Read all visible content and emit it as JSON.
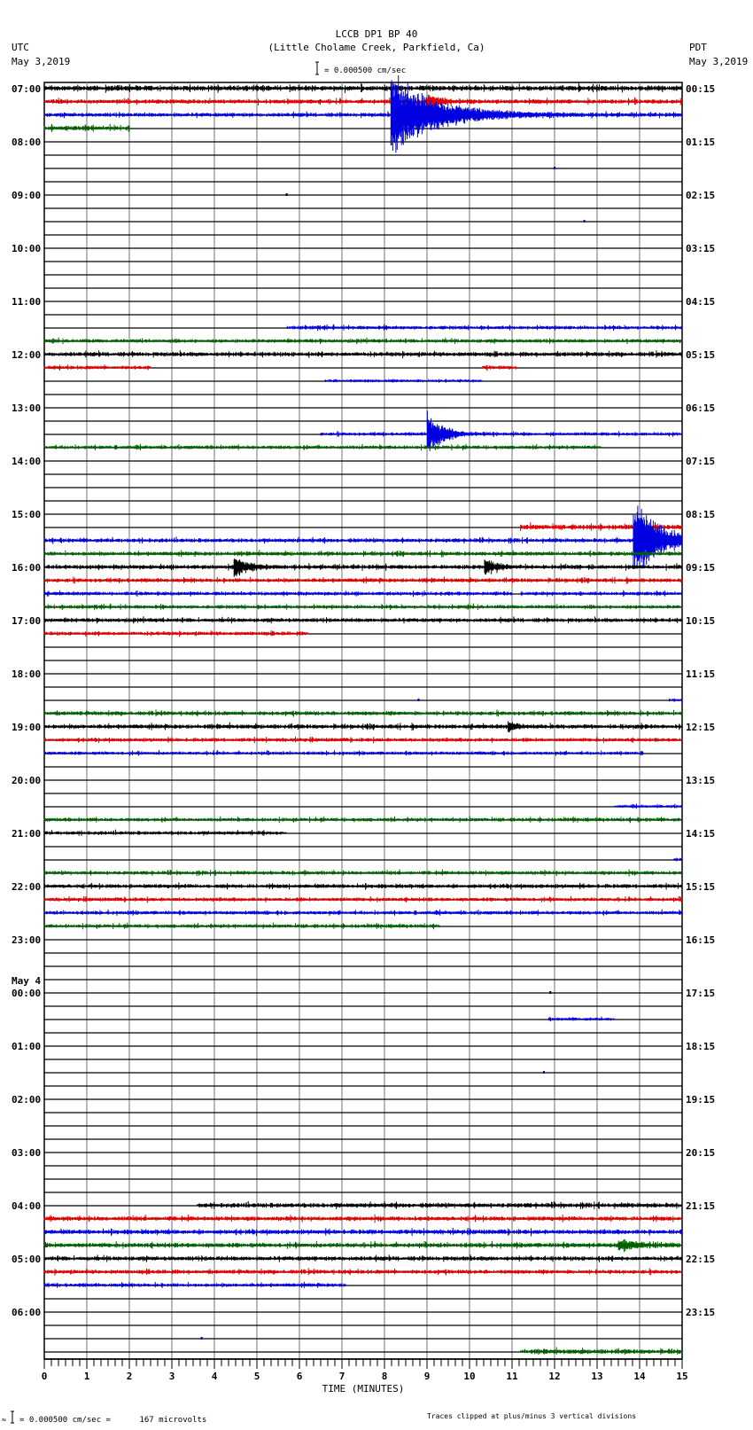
{
  "header": {
    "title": "LCCB DP1 BP 40",
    "subtitle": "(Little Cholame Creek, Parkfield, Ca)",
    "left_tz": "UTC",
    "left_date": "May 3,2019",
    "right_tz": "PDT",
    "right_date": "May 3,2019",
    "scale_text": "= 0.000500 cm/sec"
  },
  "footer": {
    "scale_text": "= 0.000500 cm/sec =      167 microvolts",
    "clip_note": "Traces clipped at plus/minus 3 vertical divisions"
  },
  "chart_data": {
    "type": "line",
    "title": "LCCB DP1 BP 40",
    "xlabel": "TIME (MINUTES)",
    "xlim": [
      0,
      15
    ],
    "x_ticks": [
      "0",
      "1",
      "2",
      "3",
      "4",
      "5",
      "6",
      "7",
      "8",
      "9",
      "10",
      "11",
      "12",
      "13",
      "14",
      "15"
    ],
    "rows_total": 96,
    "row_minutes": 15,
    "clip_divisions": 3,
    "colors": [
      "#000000",
      "#e00000",
      "#0000e0",
      "#006000"
    ],
    "left_labels": [
      "07:00",
      "08:00",
      "09:00",
      "10:00",
      "11:00",
      "12:00",
      "13:00",
      "14:00",
      "15:00",
      "16:00",
      "17:00",
      "18:00",
      "19:00",
      "20:00",
      "21:00",
      "22:00",
      "23:00",
      "00:00",
      "01:00",
      "02:00",
      "03:00",
      "04:00",
      "05:00",
      "06:00"
    ],
    "date_change_label": "May 4",
    "date_change_hour_index": 17,
    "right_labels": [
      "00:15",
      "01:15",
      "02:15",
      "03:15",
      "04:15",
      "05:15",
      "06:15",
      "07:15",
      "08:15",
      "09:15",
      "10:15",
      "11:15",
      "12:15",
      "13:15",
      "14:15",
      "15:15",
      "16:15",
      "17:15",
      "18:15",
      "19:15",
      "20:15",
      "21:15",
      "22:15",
      "23:15"
    ],
    "traces": [
      {
        "row": 0,
        "segments": [
          [
            0,
            15
          ]
        ],
        "noise": 0.17
      },
      {
        "row": 1,
        "segments": [
          [
            0,
            15
          ]
        ],
        "noise": 0.14,
        "events": [
          {
            "t": 9.0,
            "amp": 0.5,
            "decay": 0.3
          }
        ]
      },
      {
        "row": 2,
        "segments": [
          [
            0,
            15
          ]
        ],
        "noise": 0.13,
        "events": [
          {
            "t": 8.15,
            "amp": 3,
            "decay": 1.0
          }
        ]
      },
      {
        "row": 3,
        "segments": [
          [
            0,
            2
          ]
        ],
        "noise": 0.15
      },
      {
        "row": 6,
        "dots": [
          12.0
        ]
      },
      {
        "row": 8,
        "dots": [
          5.7
        ]
      },
      {
        "row": 10,
        "dots": [
          12.7
        ]
      },
      {
        "row": 18,
        "segments": [
          [
            5.7,
            15
          ]
        ],
        "noise": 0.12
      },
      {
        "row": 19,
        "segments": [
          [
            0,
            15
          ]
        ],
        "noise": 0.12
      },
      {
        "row": 20,
        "segments": [
          [
            0,
            15
          ]
        ],
        "noise": 0.14
      },
      {
        "row": 21,
        "segments": [
          [
            0,
            2.5
          ],
          [
            10.3,
            11.1
          ]
        ],
        "noise": 0.12
      },
      {
        "row": 22,
        "segments": [
          [
            6.6,
            10.3
          ]
        ],
        "noise": 0.1
      },
      {
        "row": 26,
        "segments": [
          [
            6.5,
            15
          ]
        ],
        "noise": 0.11,
        "events": [
          {
            "t": 9.0,
            "amp": 1.5,
            "decay": 0.35
          }
        ]
      },
      {
        "row": 27,
        "segments": [
          [
            0,
            13.1
          ]
        ],
        "noise": 0.12
      },
      {
        "row": 33,
        "segments": [
          [
            11.2,
            15
          ]
        ],
        "noise": 0.16
      },
      {
        "row": 34,
        "segments": [
          [
            0,
            15
          ]
        ],
        "noise": 0.13,
        "events": [
          {
            "t": 13.85,
            "amp": 3,
            "decay": 0.6
          }
        ]
      },
      {
        "row": 35,
        "segments": [
          [
            0,
            15
          ]
        ],
        "noise": 0.13
      },
      {
        "row": 36,
        "segments": [
          [
            0,
            15
          ]
        ],
        "noise": 0.14,
        "events": [
          {
            "t": 4.45,
            "amp": 0.9,
            "decay": 0.25
          },
          {
            "t": 10.35,
            "amp": 0.6,
            "decay": 0.25
          }
        ]
      },
      {
        "row": 37,
        "segments": [
          [
            0,
            15
          ]
        ],
        "noise": 0.13
      },
      {
        "row": 38,
        "segments": [
          [
            0,
            11.0
          ],
          [
            11.2,
            15
          ]
        ],
        "noise": 0.12
      },
      {
        "row": 39,
        "segments": [
          [
            0,
            15
          ]
        ],
        "noise": 0.12
      },
      {
        "row": 40,
        "segments": [
          [
            0,
            15
          ]
        ],
        "noise": 0.13
      },
      {
        "row": 41,
        "segments": [
          [
            0,
            6.2
          ]
        ],
        "noise": 0.12
      },
      {
        "row": 46,
        "segments": [
          [
            14.7,
            15
          ]
        ],
        "noise": 0.1,
        "dots": [
          8.8
        ]
      },
      {
        "row": 47,
        "segments": [
          [
            0,
            15
          ]
        ],
        "noise": 0.13
      },
      {
        "row": 48,
        "segments": [
          [
            0,
            15
          ]
        ],
        "noise": 0.14,
        "events": [
          {
            "t": 10.9,
            "amp": 0.4,
            "decay": 0.2
          }
        ]
      },
      {
        "row": 49,
        "segments": [
          [
            0,
            15
          ]
        ],
        "noise": 0.12
      },
      {
        "row": 50,
        "segments": [
          [
            0,
            14.1
          ]
        ],
        "noise": 0.11
      },
      {
        "row": 54,
        "segments": [
          [
            13.4,
            15
          ]
        ],
        "noise": 0.1
      },
      {
        "row": 55,
        "segments": [
          [
            0,
            15
          ]
        ],
        "noise": 0.12
      },
      {
        "row": 56,
        "segments": [
          [
            0,
            5.7
          ]
        ],
        "noise": 0.12
      },
      {
        "row": 58,
        "segments": [
          [
            14.8,
            15
          ]
        ],
        "noise": 0.1
      },
      {
        "row": 59,
        "segments": [
          [
            0,
            15
          ]
        ],
        "noise": 0.12
      },
      {
        "row": 60,
        "segments": [
          [
            0,
            15
          ]
        ],
        "noise": 0.13
      },
      {
        "row": 61,
        "segments": [
          [
            0,
            15
          ]
        ],
        "noise": 0.12
      },
      {
        "row": 62,
        "segments": [
          [
            0,
            15
          ]
        ],
        "noise": 0.12
      },
      {
        "row": 63,
        "segments": [
          [
            0,
            9.3
          ]
        ],
        "noise": 0.12
      },
      {
        "row": 68,
        "dots": [
          11.9
        ]
      },
      {
        "row": 70,
        "segments": [
          [
            11.85,
            13.4
          ]
        ],
        "noise": 0.1
      },
      {
        "row": 74,
        "dots": [
          11.75
        ]
      },
      {
        "row": 84,
        "segments": [
          [
            3.6,
            15
          ]
        ],
        "noise": 0.15
      },
      {
        "row": 85,
        "segments": [
          [
            0,
            15
          ]
        ],
        "noise": 0.14
      },
      {
        "row": 86,
        "segments": [
          [
            0,
            15
          ]
        ],
        "noise": 0.15
      },
      {
        "row": 87,
        "segments": [
          [
            0,
            15
          ]
        ],
        "noise": 0.15,
        "events": [
          {
            "t": 13.5,
            "amp": 0.35,
            "decay": 0.4
          }
        ]
      },
      {
        "row": 88,
        "segments": [
          [
            0,
            15
          ]
        ],
        "noise": 0.14
      },
      {
        "row": 89,
        "segments": [
          [
            0,
            15
          ]
        ],
        "noise": 0.13
      },
      {
        "row": 90,
        "segments": [
          [
            0,
            7.1
          ]
        ],
        "noise": 0.12
      },
      {
        "row": 94,
        "dots": [
          3.7
        ]
      },
      {
        "row": 95,
        "segments": [
          [
            11.2,
            15
          ]
        ],
        "noise": 0.15
      }
    ]
  }
}
